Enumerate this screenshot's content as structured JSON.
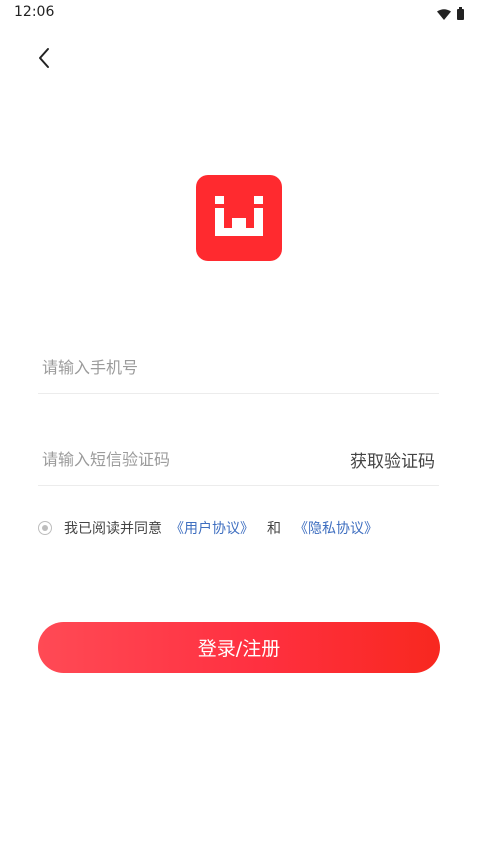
{
  "status_bar": {
    "time": "12:06",
    "icons": [
      "wifi-icon",
      "battery-icon"
    ]
  },
  "header": {
    "back_icon": "chevron-left-icon"
  },
  "logo": {
    "icon": "brand-logo-icon",
    "color": "#ff2a2f"
  },
  "form": {
    "phone_placeholder": "请输入手机号",
    "phone_value": "",
    "code_placeholder": "请输入短信验证码",
    "code_value": "",
    "get_code_label": "获取验证码"
  },
  "agreement": {
    "checked": false,
    "text": "我已阅读并同意",
    "user_agreement": "《用户协议》",
    "and_text": "和",
    "privacy_policy": "《隐私协议》",
    "link_color": "#3f6fc0"
  },
  "submit": {
    "label": "登录/注册"
  }
}
